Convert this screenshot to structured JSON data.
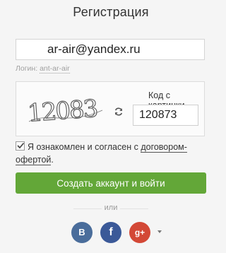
{
  "header": {
    "title": "Регистрация"
  },
  "form": {
    "email_value": "ar-air@yandex.ru",
    "login_label": "Логин:",
    "login_value": "ant-ar-air"
  },
  "captcha": {
    "image_text": "12083",
    "refresh_icon": "refresh-icon",
    "label": "Код с картинки",
    "input_value": "120873"
  },
  "agreement": {
    "checked": true,
    "text": "Я ознакомлен и согласен с",
    "link_text": "договором-офертой",
    "suffix": "."
  },
  "actions": {
    "submit_label": "Создать аккаунт и войти",
    "divider_text": "или"
  },
  "social": [
    {
      "name": "vk",
      "label": "В",
      "color": "#4a6d9b"
    },
    {
      "name": "facebook",
      "label": "f",
      "color": "#3b5998"
    },
    {
      "name": "google-plus",
      "label": "g+",
      "color": "#d34836"
    }
  ],
  "colors": {
    "accent": "#63a738",
    "background": "#f5f5f5"
  }
}
